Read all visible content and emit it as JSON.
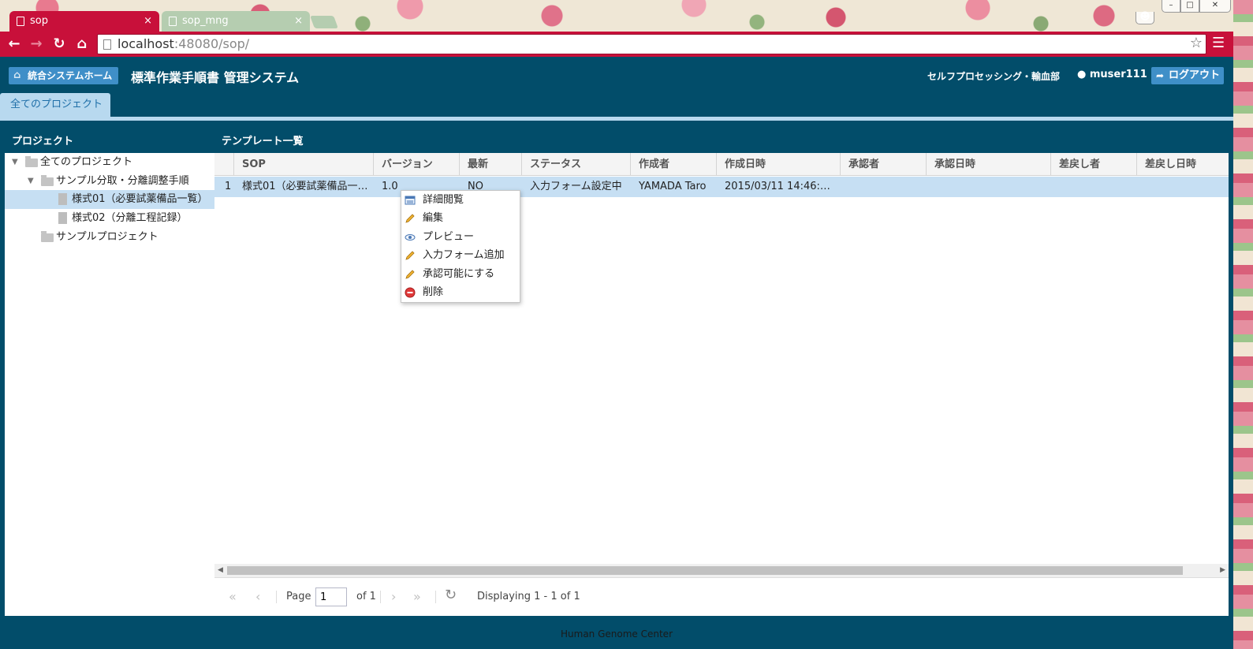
{
  "browser": {
    "tabs": [
      {
        "label": "sop",
        "close": "×"
      },
      {
        "label": "sop_mng",
        "close": "×"
      }
    ],
    "url_host": "localhost",
    "url_port_path": ":48080/sop/"
  },
  "header": {
    "home_button": "統合システムホーム",
    "title": "標準作業手順書 管理システム",
    "department": "セルフプロセッシング・輸血部",
    "username": "muser111",
    "logout_button": "ログアウト"
  },
  "project_tab": "全てのプロジェクト",
  "tree": {
    "heading": "プロジェクト",
    "items": [
      {
        "label": "全てのプロジェクト"
      },
      {
        "label": "サンプル分取・分離調整手順"
      },
      {
        "label": "様式01（必要試薬備品一覧）"
      },
      {
        "label": "様式02（分離工程記録）"
      },
      {
        "label": "サンプルプロジェクト"
      }
    ]
  },
  "grid": {
    "heading": "テンプレート一覧",
    "columns": [
      "SOP",
      "バージョン",
      "最新",
      "ステータス",
      "作成者",
      "作成日時",
      "承認者",
      "承認日時",
      "差戻し者",
      "差戻し日時"
    ],
    "rows": [
      {
        "num": "1",
        "sop": "様式01（必要試薬備品一…",
        "version": "1.0",
        "latest": "NO",
        "status": "入力フォーム設定中",
        "author": "YAMADA Taro",
        "created": "2015/03/11 14:46:…",
        "approver": "",
        "approved": "",
        "returner": "",
        "returned": ""
      }
    ]
  },
  "context_menu": {
    "items": [
      {
        "label": "詳細閲覧",
        "icon": "detail-icon"
      },
      {
        "label": "編集",
        "icon": "pencil-icon"
      },
      {
        "label": "プレビュー",
        "icon": "eye-icon"
      },
      {
        "label": "入力フォーム追加",
        "icon": "pencil-icon"
      },
      {
        "label": "承認可能にする",
        "icon": "pencil-icon"
      },
      {
        "label": "削除",
        "icon": "delete-icon"
      }
    ]
  },
  "pager": {
    "page_label": "Page",
    "page_value": "1",
    "of_label": "of 1",
    "displaying": "Displaying 1 - 1 of 1"
  },
  "footer": "Human Genome Center",
  "colors": {
    "chrome_red": "#c8103a",
    "app_bg": "#024d6a",
    "accent_blue": "#3f8fc8",
    "selection": "#c6dff3"
  }
}
